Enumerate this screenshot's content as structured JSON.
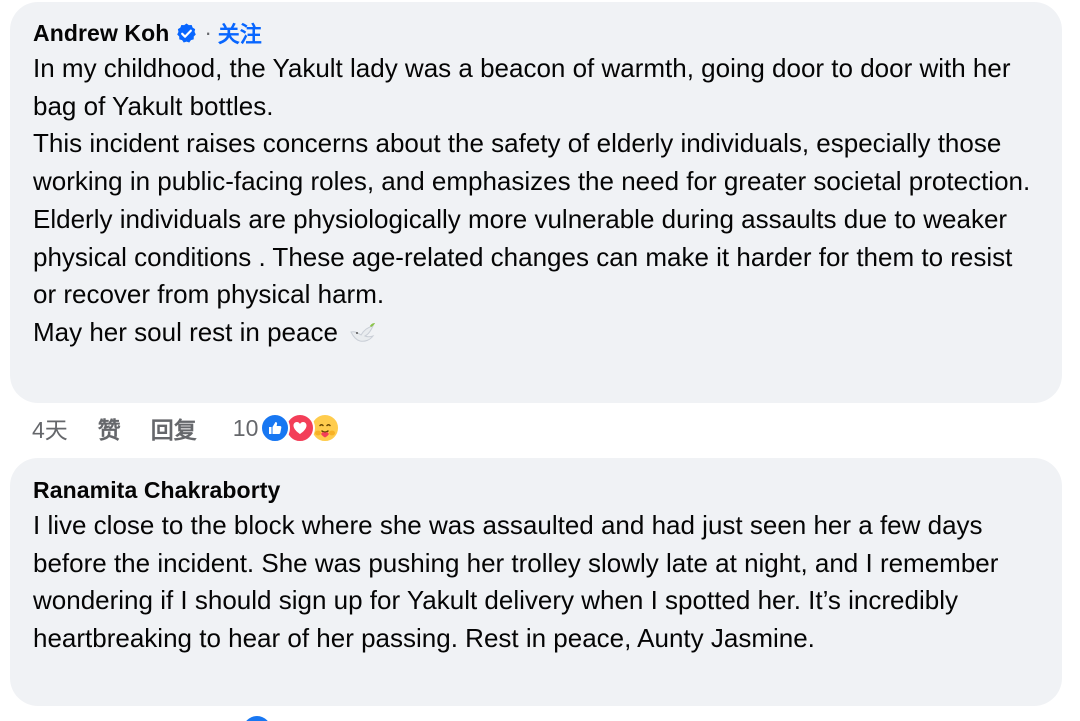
{
  "comments": [
    {
      "author": "Andrew Koh",
      "verified": true,
      "separator": "·",
      "follow_label": "关注",
      "paragraphs": [
        "In my childhood, the Yakult lady was a beacon of warmth, going door to door with her bag of Yakult bottles.",
        "This incident raises concerns about the safety of elderly individuals, especially those working in public-facing roles, and emphasizes the need for greater societal protection. Elderly individuals are physiologically more vulnerable during assaults due to weaker physical conditions . These age-related changes can make it harder for them to resist or recover from physical harm.",
        "May her soul rest in peace"
      ],
      "emoji": "dove-icon",
      "time": "4天",
      "like_label": "赞",
      "reply_label": "回复",
      "reaction_count": "10",
      "reactions": [
        "like-reaction-icon",
        "love-reaction-icon",
        "care-reaction-icon"
      ]
    },
    {
      "author": "Ranamita Chakraborty",
      "paragraphs": [
        "I live close to the block where she was assaulted and had just seen her a few days before the incident. She was pushing her trolley slowly late at night, and I remember wondering if I should sign up for Yakult delivery when I spotted her. It’s incredibly heartbreaking to hear of her passing. Rest in peace, Aunty Jasmine."
      ]
    }
  ],
  "colors": {
    "bubble_bg": "#f0f2f5",
    "link_blue": "#0866ff",
    "secondary_text": "#65676b",
    "like_blue": "#1877f2",
    "love_red": "#f33e58",
    "care_yellow": "#ffcc4d"
  }
}
